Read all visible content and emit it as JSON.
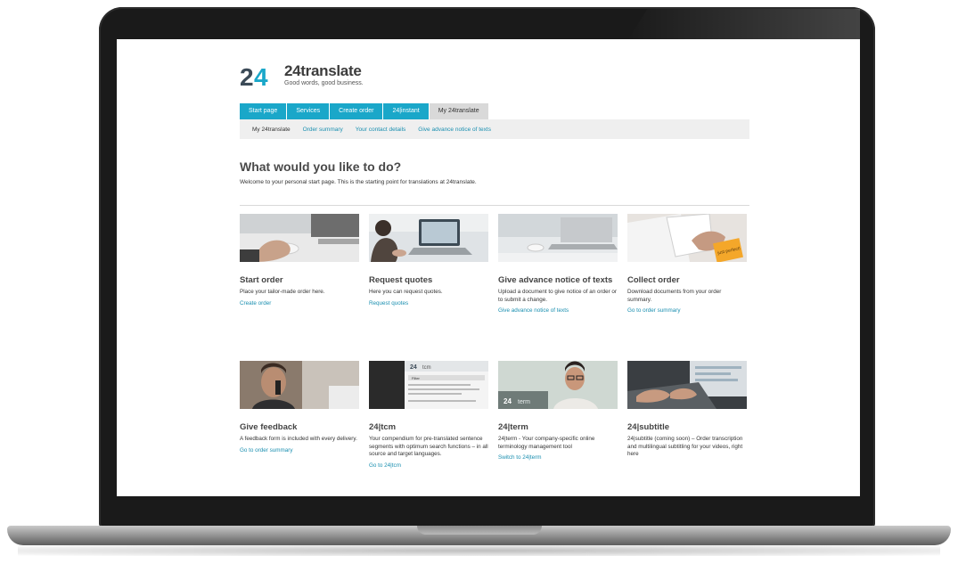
{
  "logo": {
    "mark": "24",
    "name": "24translate",
    "tagline": "Good words, good business."
  },
  "nav": {
    "tabs": [
      "Start page",
      "Services",
      "Create order",
      "24|instant",
      "My 24translate"
    ],
    "active": "My 24translate"
  },
  "subnav": {
    "items": [
      "My 24translate",
      "Order summary",
      "Your contact details",
      "Give advance notice of texts"
    ],
    "current": "My 24translate"
  },
  "heading": "What would you like to do?",
  "intro": "Welcome to your personal start page. This is the starting point for translations at 24translate.",
  "cards": [
    {
      "title": "Start order",
      "desc": "Place your tailor-made order here.",
      "link": "Create order",
      "image": "hand-on-mouse"
    },
    {
      "title": "Request quotes",
      "desc": "Here you can request quotes.",
      "link": "Request quotes",
      "image": "person-at-laptop"
    },
    {
      "title": "Give advance notice of texts",
      "desc": "Upload a document to give notice of an order or to submit a change.",
      "link": "Give advance notice of texts",
      "image": "laptop-on-desk"
    },
    {
      "title": "Collect order",
      "desc": "Download documents from your order summary.",
      "link": "Go to order summary",
      "image": "document-with-sticky-note"
    },
    {
      "title": "Give feedback",
      "desc": "A feedback form is included with every delivery.",
      "link": "Go to order summary",
      "image": "man-on-phone"
    },
    {
      "title": "24|tcm",
      "desc": "Your compendium for pre-translated sentence segments with optimum search functions – in all source and target languages.",
      "link": "Go to 24|tcm",
      "image": "tcm-screenshot"
    },
    {
      "title": "24|term",
      "desc": "24|term - Your company-specific online terminology management tool",
      "link": "Switch to 24|term",
      "image": "man-with-glasses"
    },
    {
      "title": "24|subtitle",
      "desc": "24|subtitle (coming soon) – Order transcription and multilingual subtitling for your videos, right here",
      "link": "",
      "image": "hands-on-keyboard"
    }
  ],
  "image_text": {
    "sticky_note": "just perfect!",
    "tcm_label": "tcm",
    "term_label": "term",
    "filter_label": "Filter"
  },
  "colors": {
    "accent": "#1aa7c9",
    "link": "#1a8fb0",
    "bezel": "#1a1a1a"
  }
}
